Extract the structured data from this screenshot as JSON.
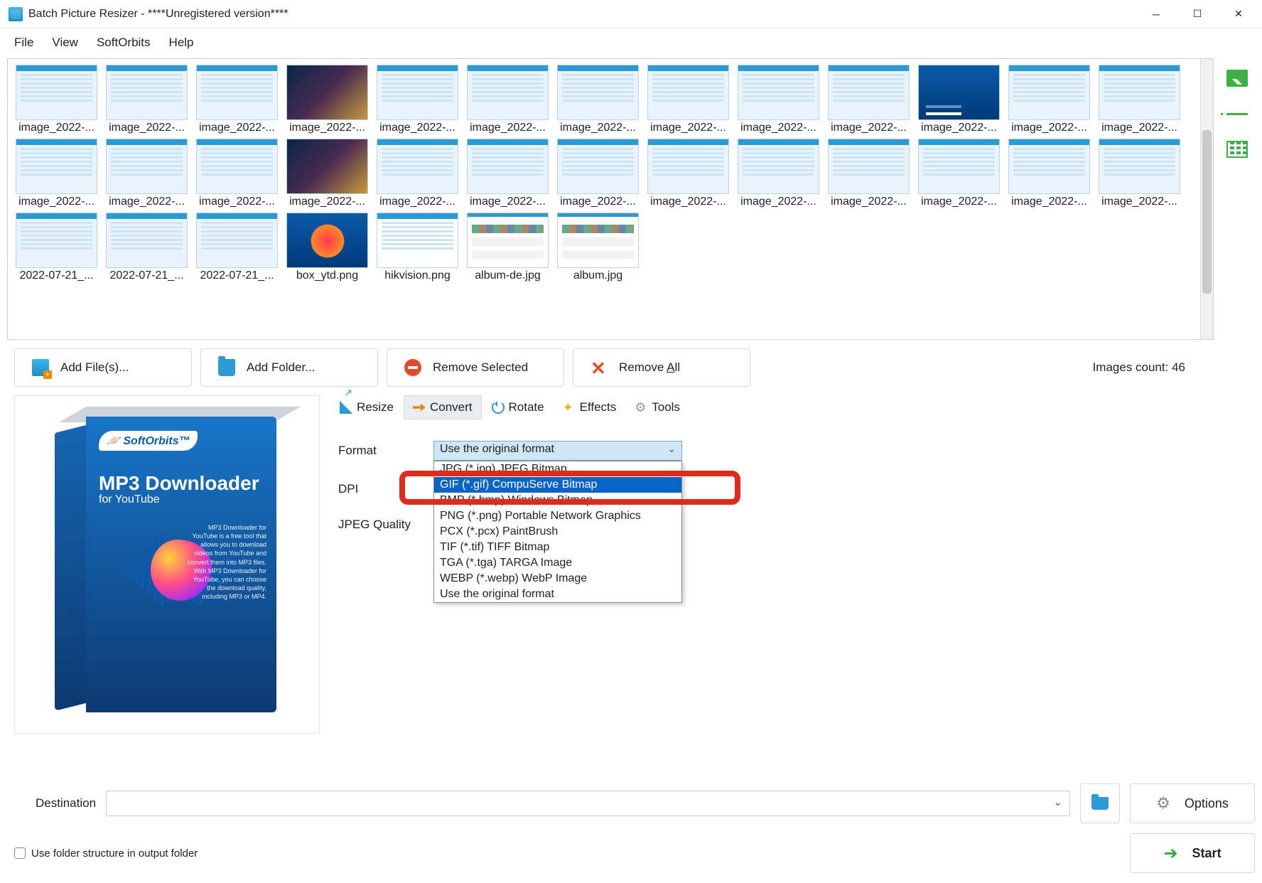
{
  "title": "Batch Picture Resizer - ****Unregistered version****",
  "menu": {
    "file": "File",
    "view": "View",
    "softorbits": "SoftOrbits",
    "help": "Help"
  },
  "thumbs": {
    "row1": [
      "image_2022-...",
      "image_2022-...",
      "image_2022-...",
      "image_2022-...",
      "image_2022-...",
      "image_2022-...",
      "image_2022-...",
      "image_2022-...",
      "image_2022-...",
      "image_2022-...",
      "image_2022-...",
      "image_2022-...",
      "image_2022-..."
    ],
    "row2": [
      "image_2022-...",
      "image_2022-...",
      "image_2022-...",
      "image_2022-...",
      "image_2022-...",
      "image_2022-...",
      "image_2022-...",
      "image_2022-...",
      "image_2022-...",
      "image_2022-...",
      "image_2022-...",
      "image_2022-...",
      "image_2022-..."
    ],
    "row3": [
      "2022-07-21_...",
      "2022-07-21_...",
      "2022-07-21_...",
      "box_ytd.png",
      "hikvision.png",
      "album-de.jpg",
      "album.jpg"
    ]
  },
  "actions": {
    "add_files": "Add File(s)...",
    "add_folder": "Add Folder...",
    "remove_selected": "Remove Selected",
    "remove_all_prefix": "Remove ",
    "remove_all_u": "A",
    "remove_all_suffix": "ll"
  },
  "count_label": "Images count: 46",
  "tabs": {
    "resize": "Resize",
    "convert": "Convert",
    "rotate": "Rotate",
    "effects": "Effects",
    "tools": "Tools"
  },
  "form": {
    "format_label": "Format",
    "dpi_label": "DPI",
    "jpeg_label": "JPEG Quality",
    "format_selected": "Use the original format",
    "options": [
      "JPG (*.jpg) JPEG Bitmap",
      "GIF (*.gif) CompuServe Bitmap",
      "BMP (*.bmp) Windows Bitmap",
      "PNG (*.png) Portable Network Graphics",
      "PCX (*.pcx) PaintBrush",
      "TIF (*.tif) TIFF Bitmap",
      "TGA (*.tga) TARGA Image",
      "WEBP (*.webp) WebP Image",
      "Use the original format"
    ],
    "highlight_index": 1
  },
  "preview": {
    "brand": "SoftOrbits",
    "product": "MP3 Downloader",
    "product_sub": "for YouTube",
    "desc": "MP3 Downloader for YouTube is a free tool that allows you to download videos from YouTube and convert them into MP3 files. With MP3 Downloader for YouTube, you can choose the download quality, including MP3 or MP4."
  },
  "bottom": {
    "destination": "Destination",
    "options": "Options",
    "start": "Start",
    "folder_struct": "Use folder structure in output folder"
  }
}
